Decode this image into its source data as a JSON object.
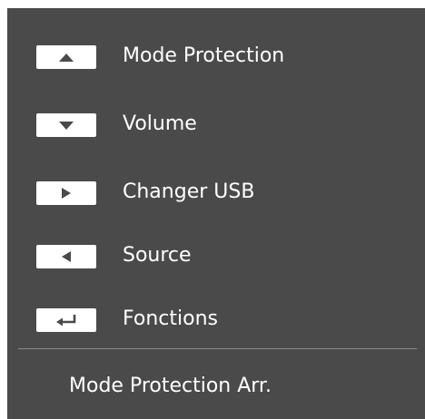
{
  "menu": {
    "items": [
      {
        "icon": "arrow-up-icon",
        "label": "Mode Protection"
      },
      {
        "icon": "arrow-down-icon",
        "label": "Volume"
      },
      {
        "icon": "arrow-right-icon",
        "label": "Changer USB"
      },
      {
        "icon": "arrow-left-icon",
        "label": "Source"
      },
      {
        "icon": "enter-icon",
        "label": "Fonctions"
      }
    ]
  },
  "status": {
    "text": "Mode Protection Arr."
  },
  "colors": {
    "panel": "#4a4a4a",
    "text": "#ffffff",
    "key": "#ffffff",
    "glyph": "#4a4a4a",
    "divider": "#8a8a8a"
  }
}
